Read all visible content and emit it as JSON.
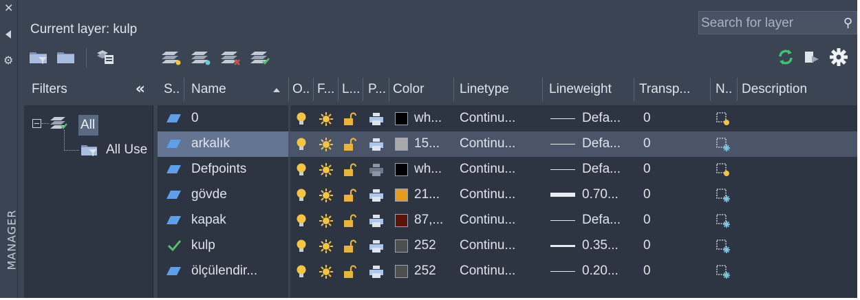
{
  "panel": {
    "current_layer": "Current layer: kulp",
    "search_placeholder": "Search for layer",
    "side_label": "MANAGER"
  },
  "filters": {
    "title": "Filters",
    "tree": [
      {
        "label": "All",
        "selected": true
      },
      {
        "label": "All Use",
        "selected": false
      }
    ]
  },
  "columns": [
    "S..",
    "Name",
    "O..",
    "F...",
    "L...",
    "P...",
    "Color",
    "Linetype",
    "Lineweight",
    "Transp...",
    "N..",
    "Description"
  ],
  "layers": [
    {
      "status": "layer",
      "name": "0",
      "printable": true,
      "color_hex": "#000000",
      "color_label": "wh...",
      "linetype": "Continu...",
      "lineweight": "Defa...",
      "lw_style": "thin",
      "transparency": "0",
      "newvp": "sun"
    },
    {
      "status": "layer",
      "name": "arkalık",
      "printable": true,
      "color_hex": "#a8a8a8",
      "color_label": "15...",
      "linetype": "Continu...",
      "lineweight": "Defa...",
      "lw_style": "thin",
      "transparency": "0",
      "newvp": "freeze",
      "selected": true
    },
    {
      "status": "layer",
      "name": "Defpoints",
      "printable": false,
      "color_hex": "#000000",
      "color_label": "wh...",
      "linetype": "Continu...",
      "lineweight": "Defa...",
      "lw_style": "thin",
      "transparency": "0",
      "newvp": "sun"
    },
    {
      "status": "layer",
      "name": "gövde",
      "printable": true,
      "color_hex": "#e59c1c",
      "color_label": "21...",
      "linetype": "Continu...",
      "lineweight": "0.70...",
      "lw_style": "thick",
      "transparency": "0",
      "newvp": "freeze"
    },
    {
      "status": "layer",
      "name": "kapak",
      "printable": true,
      "color_hex": "#5a1508",
      "color_label": "87,...",
      "linetype": "Continu...",
      "lineweight": "Defa...",
      "lw_style": "thin",
      "transparency": "0",
      "newvp": "freeze"
    },
    {
      "status": "current",
      "name": "kulp",
      "printable": true,
      "color_hex": "#4f4f4f",
      "color_label": "252",
      "linetype": "Continu...",
      "lineweight": "0.35...",
      "lw_style": "medium",
      "transparency": "0",
      "newvp": "freeze"
    },
    {
      "status": "layer",
      "name": "ölçülendir...",
      "printable": true,
      "color_hex": "#4f4f4f",
      "color_label": "252",
      "linetype": "Continu...",
      "lineweight": "0.20...",
      "lw_style": "thin2",
      "transparency": "0",
      "newvp": "freeze"
    }
  ],
  "colors": {
    "background": "#3b4453",
    "grid_background": "#2d3442",
    "selected_row": "#4a556a",
    "bulb": "#f5c542",
    "sun": "#f5c542",
    "lock": "#e8b53a",
    "current_check": "#54c06b",
    "refresh": "#3ec46d"
  }
}
